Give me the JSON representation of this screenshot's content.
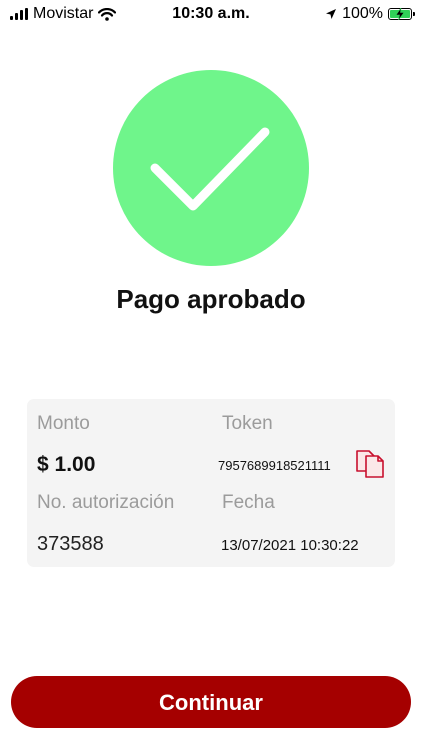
{
  "status_bar": {
    "carrier": "Movistar",
    "time": "10:30 a.m.",
    "battery": "100%",
    "icons": [
      "signal-icon",
      "wifi-icon",
      "location-arrow-icon",
      "battery-charging-icon"
    ]
  },
  "result": {
    "title": "Pago aprobado",
    "icon": "checkmark-icon",
    "color": "#6ff58b"
  },
  "details": {
    "amount_label": "Monto",
    "amount_value": "$ 1.00",
    "token_label": "Token",
    "token_value": "7957689918521111",
    "copy_icon": "copy-icon",
    "authorization_label": "No. autorización",
    "authorization_value": "373588",
    "date_label": "Fecha",
    "date_value": "13/07/2021 10:30:22"
  },
  "actions": {
    "continue_label": "Continuar",
    "accent_color": "#a50000"
  }
}
